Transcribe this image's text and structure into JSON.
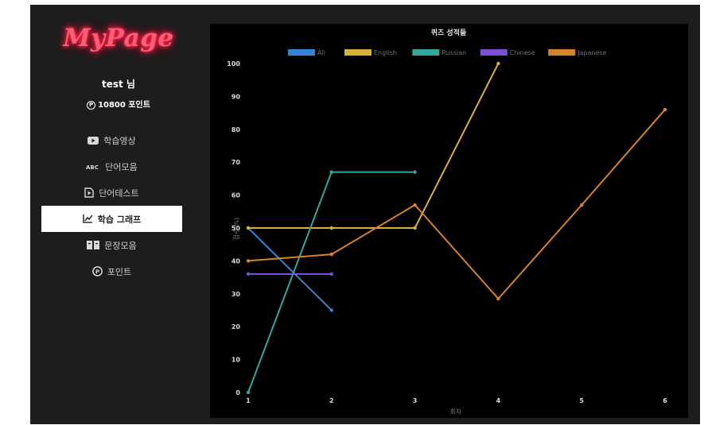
{
  "sidebar": {
    "logo": "MyPage",
    "user_name": "test 님",
    "points": "10800 포인트",
    "menu": [
      {
        "label": "학습영상",
        "icon": "youtube-icon",
        "active": false
      },
      {
        "label": "단어모음",
        "icon": "abc-icon",
        "active": false
      },
      {
        "label": "단어테스트",
        "icon": "test-icon",
        "active": false
      },
      {
        "label": "학습 그래프",
        "icon": "chart-icon",
        "active": true
      },
      {
        "label": "문장모음",
        "icon": "book-icon",
        "active": false
      },
      {
        "label": "포인트",
        "icon": "point-icon",
        "active": false
      }
    ]
  },
  "colors": {
    "panel_bg": "#1d1d1d",
    "chart_bg": "#000000",
    "logo_neon": "#ff5d73"
  },
  "chart_data": {
    "type": "line",
    "title": "퀴즈 성적들",
    "xlabel": "회차",
    "ylabel": "점수(%)",
    "x_ticks": [
      "1",
      "2",
      "3",
      "4",
      "5",
      "6"
    ],
    "y_ticks": [
      "0",
      "10",
      "20",
      "30",
      "40",
      "50",
      "60",
      "70",
      "80",
      "90",
      "100"
    ],
    "ylim": [
      0,
      100
    ],
    "legend_position": "top",
    "grid": false,
    "series": [
      {
        "name": "All",
        "color": "#2f86d6",
        "values": [
          50,
          25
        ]
      },
      {
        "name": "English",
        "color": "#d8b13c",
        "values": [
          50,
          50,
          50,
          100
        ]
      },
      {
        "name": "Russian",
        "color": "#34a79e",
        "values": [
          0,
          67,
          67
        ]
      },
      {
        "name": "Chinese",
        "color": "#7b4fd6",
        "values": [
          36,
          36
        ]
      },
      {
        "name": "Japanese",
        "color": "#d9822b",
        "values": [
          40,
          42,
          57,
          28.5,
          57,
          86
        ]
      }
    ]
  }
}
